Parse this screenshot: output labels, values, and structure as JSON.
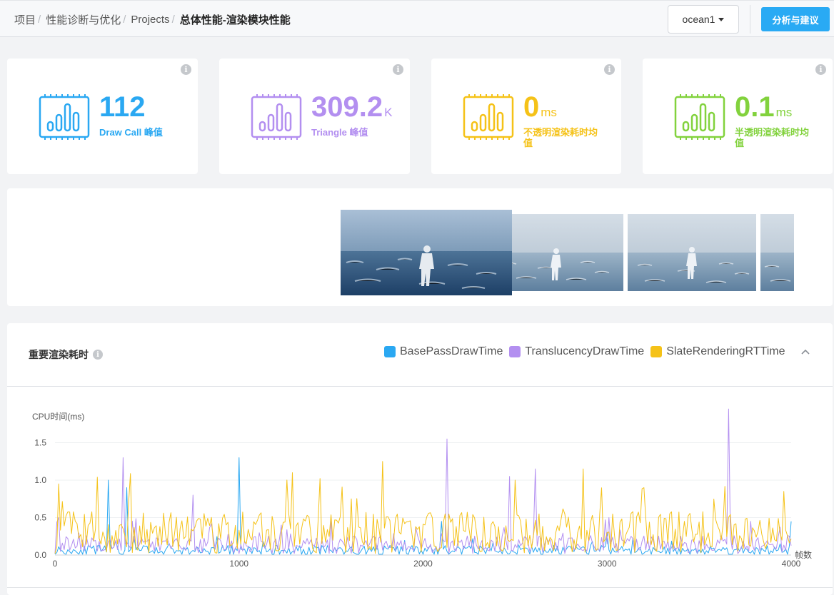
{
  "breadcrumb": {
    "items": [
      "项目",
      "性能诊断与优化",
      "Projects"
    ],
    "current": "总体性能-渲染模块性能"
  },
  "header": {
    "dropdown_value": "ocean1",
    "action_button": "分析与建议"
  },
  "stats": [
    {
      "value": "112",
      "unit": "",
      "label": "Draw Call 峰值",
      "color": "#2aa8f2"
    },
    {
      "value": "309.2",
      "unit": "K",
      "label": "Triangle 峰值",
      "color": "#b38ff0"
    },
    {
      "value": "0",
      "unit": "ms",
      "label": "不透明渲染耗时均值",
      "color": "#f5c218"
    },
    {
      "value": "0.1",
      "unit": "ms",
      "label": "半透明渲染耗时均值",
      "color": "#82d23d"
    }
  ],
  "gallery": {
    "thumbnails": [
      {
        "name": "frame-thumbnail-1",
        "scene": "ocean-runner-dark"
      },
      {
        "name": "frame-thumbnail-2",
        "scene": "ocean-runner-light"
      },
      {
        "name": "frame-thumbnail-3",
        "scene": "ocean-runner-light"
      },
      {
        "name": "frame-thumbnail-4",
        "scene": "ocean-runner-light"
      }
    ]
  },
  "chart_panel": {
    "title": "重要渲染耗时",
    "legend": [
      {
        "name": "BasePassDrawTime",
        "color": "#2aa8f2"
      },
      {
        "name": "TranslucencyDrawTime",
        "color": "#b38ff0"
      },
      {
        "name": "SlateRenderingRTTime",
        "color": "#f5c218"
      }
    ]
  },
  "chart_data": {
    "type": "line",
    "ylabel": "CPU时间(ms)",
    "xlabel": "帧数",
    "xlim": [
      0,
      4000
    ],
    "ylim": [
      0,
      2.0
    ],
    "x_ticks": [
      0,
      1000,
      2000,
      3000,
      4000
    ],
    "y_ticks": [
      0.0,
      0.5,
      1.0,
      1.5
    ],
    "y_tick_labels": [
      "0.0",
      "0.5",
      "1.0",
      "1.5"
    ],
    "grid": true,
    "x_step": 10,
    "series": [
      {
        "name": "BasePassDrawTime",
        "color": "#2aa8f2",
        "base": 0.06,
        "noise": 0.07,
        "seed": 11,
        "spikes": [
          [
            290,
            1.0
          ],
          [
            390,
            0.9
          ],
          [
            1000,
            1.3
          ],
          [
            2100,
            0.45
          ],
          [
            3000,
            0.3
          ],
          [
            4000,
            0.45
          ]
        ]
      },
      {
        "name": "TranslucencyDrawTime",
        "color": "#b38ff0",
        "base": 0.14,
        "noise": 0.12,
        "seed": 37,
        "spikes": [
          [
            20,
            0.5
          ],
          [
            370,
            1.3
          ],
          [
            750,
            0.8
          ],
          [
            1230,
            0.4
          ],
          [
            2130,
            1.55
          ],
          [
            2470,
            1.05
          ],
          [
            2610,
            1.15
          ],
          [
            3010,
            0.5
          ],
          [
            3660,
            1.95
          ],
          [
            3780,
            0.45
          ]
        ]
      },
      {
        "name": "SlateRenderingRTTime",
        "color": "#f5c218",
        "base": 0.3,
        "noise": 0.28,
        "seed": 73,
        "spikes": [
          [
            20,
            0.95
          ],
          [
            1290,
            1.1
          ],
          [
            1780,
            1.25
          ],
          [
            2500,
            1.0
          ],
          [
            2870,
            1.15
          ],
          [
            3200,
            0.9
          ],
          [
            3960,
            0.85
          ]
        ]
      }
    ]
  }
}
